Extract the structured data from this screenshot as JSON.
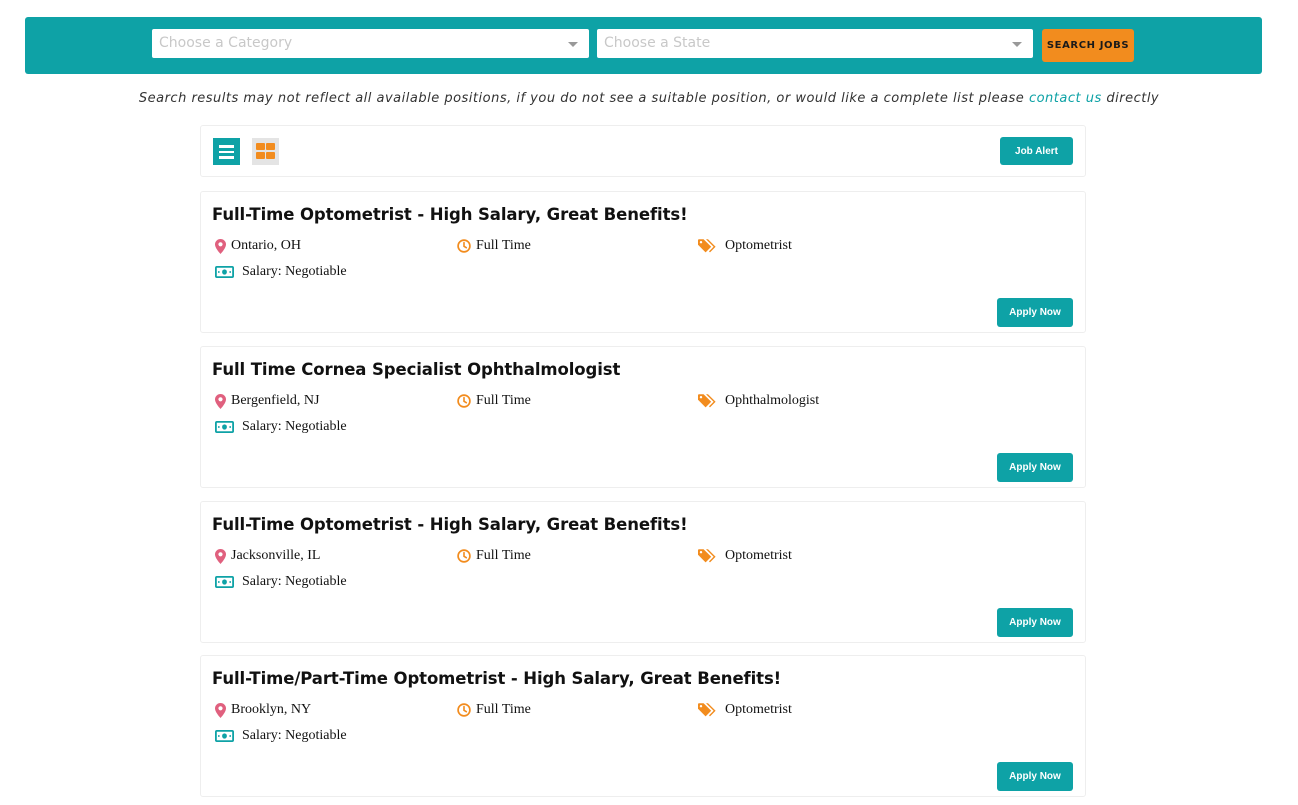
{
  "search": {
    "category_placeholder": "Choose a Category",
    "state_placeholder": "Choose a State",
    "button_label": "SEARCH JOBS"
  },
  "notice": {
    "text_before": "Search results may not reflect all available positions, if you do not see a suitable position, or would like a complete list please ",
    "link_text": "contact us",
    "text_after": " directly"
  },
  "toolbar": {
    "job_alert_label": "Job Alert"
  },
  "colors": {
    "accent": "#0ea2a6",
    "orange": "#f28c1e",
    "pin": "#e0607e"
  },
  "jobs": [
    {
      "title": "Full-Time Optometrist - High Salary, Great Benefits!",
      "location": "Ontario, OH",
      "type": "Full Time",
      "category": "Optometrist",
      "salary": "Salary: Negotiable",
      "apply_label": "Apply Now"
    },
    {
      "title": "Full Time Cornea Specialist Ophthalmologist",
      "location": "Bergenfield, NJ",
      "type": "Full Time",
      "category": "Ophthalmologist",
      "salary": "Salary: Negotiable",
      "apply_label": "Apply Now"
    },
    {
      "title": "Full-Time Optometrist - High Salary, Great Benefits!",
      "location": "Jacksonville, IL",
      "type": "Full Time",
      "category": "Optometrist",
      "salary": "Salary: Negotiable",
      "apply_label": "Apply Now"
    },
    {
      "title": "Full-Time/Part-Time Optometrist - High Salary, Great Benefits!",
      "location": "Brooklyn, NY",
      "type": "Full Time",
      "category": "Optometrist",
      "salary": "Salary: Negotiable",
      "apply_label": "Apply Now"
    }
  ]
}
